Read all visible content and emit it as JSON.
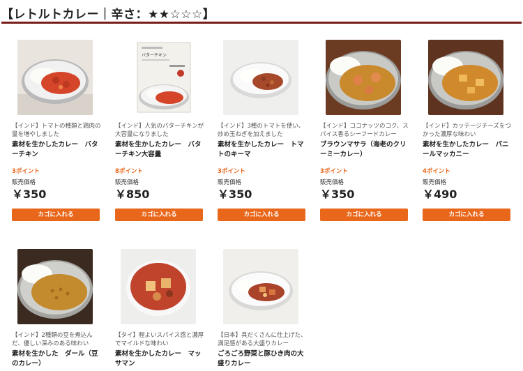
{
  "header": {
    "title": "【レトルトカレー｜辛さ：★★☆☆☆】",
    "rule_color": "#7a1c1c"
  },
  "colors": {
    "accent": "#e8671b"
  },
  "products": [
    {
      "description": "【インド】トマトの種類と鶏肉の量を増やしました",
      "name": "素材を生かしたカレー　バターチキン",
      "points": "3ポイント",
      "price_label": "販売価格",
      "price": "￥350",
      "cart_label": "カゴに入れる",
      "image": "plate-red-curry"
    },
    {
      "description": "【インド】人気のバターチキンが大容量になりました",
      "name": "素材を生かしたカレー　バターチキン大容量",
      "points": "8ポイント",
      "price_label": "販売価格",
      "price": "￥850",
      "cart_label": "カゴに入れる",
      "image": "package-butter-chicken",
      "package_text": "バターチキン"
    },
    {
      "description": "【インド】3種のトマトを使い、炒め玉ねぎを加えました",
      "name": "素材を生かしたカレー　トマトのキーマ",
      "points": "3ポイント",
      "price_label": "販売価格",
      "price": "￥350",
      "cart_label": "カゴに入れる",
      "image": "plate-keema"
    },
    {
      "description": "【インド】ココナッツのコク、スパイス香るシーフードカレー",
      "name": "ブラウンマサラ（海老のクリーミーカレー）",
      "points": "3ポイント",
      "price_label": "販売価格",
      "price": "￥350",
      "cart_label": "カゴに入れる",
      "image": "plate-shrimp-curry"
    },
    {
      "description": "【インド】カッテージチーズをつかった濃厚な味わい",
      "name": "素材を生かしたカレー　パニールマッカニー",
      "points": "4ポイント",
      "price_label": "販売価格",
      "price": "￥490",
      "cart_label": "カゴに入れる",
      "image": "plate-paneer-curry"
    },
    {
      "description": "【インド】2種類の豆を煮込んだ、優しい深みのある味わい",
      "name": "素材を生かした　ダール（豆のカレー）",
      "image": "plate-dal-curry"
    },
    {
      "description": "【タイ】程よいスパイス感と濃厚でマイルドな味わい",
      "name": "素材を生かしたカレー　マッサマン",
      "image": "bowl-massaman"
    },
    {
      "description": "【日本】具だくさんに仕上げた、満足感がある大盛りカレー",
      "name": "ごろごろ野菜と豚ひき肉の大盛りカレー",
      "image": "plate-pork-vegetable"
    }
  ]
}
